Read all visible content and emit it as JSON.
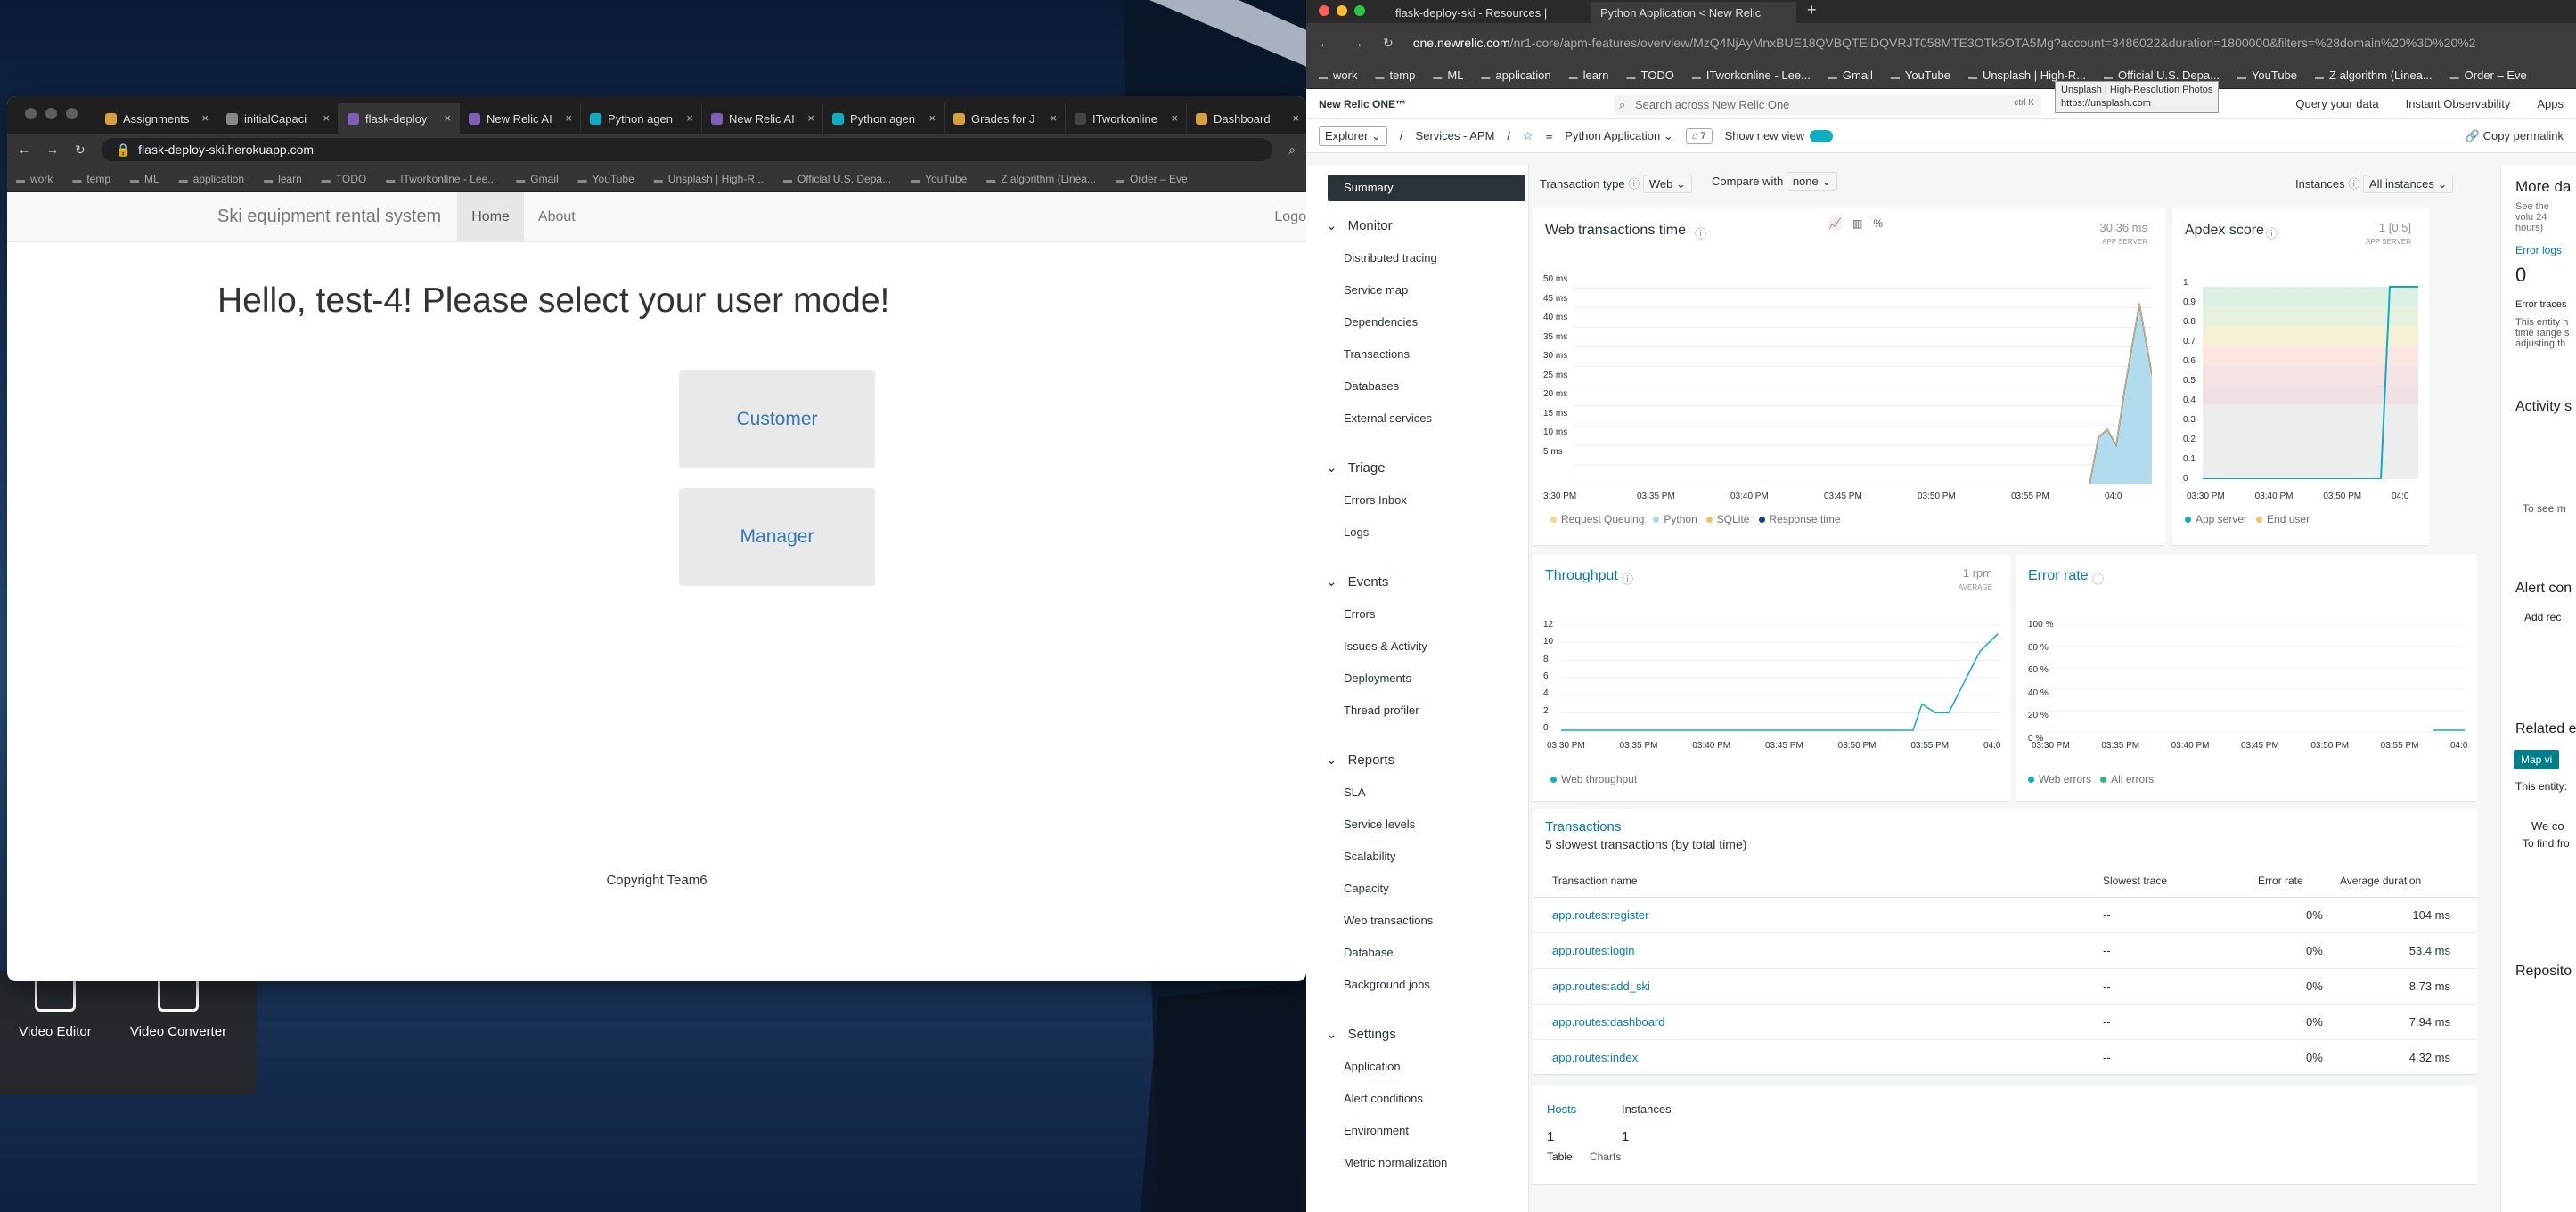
{
  "left_browser": {
    "tabs": [
      {
        "label": "Assignments",
        "color": "#d8a03a"
      },
      {
        "label": "initialCapaci",
        "color": "#888"
      },
      {
        "label": "flask-deploy",
        "color": "#7f5fb8"
      },
      {
        "label": "New Relic AI",
        "color": "#7f5fb8"
      },
      {
        "label": "Python agen",
        "color": "#0ab0bf"
      },
      {
        "label": "New Relic AI",
        "color": "#7f5fb8"
      },
      {
        "label": "Python agen",
        "color": "#0ab0bf"
      },
      {
        "label": "Grades for J",
        "color": "#d8a03a"
      },
      {
        "label": "ITworkonline",
        "color": "#444"
      },
      {
        "label": "Dashboard",
        "color": "#d8a03a"
      }
    ],
    "url": "flask-deploy-ski.herokuapp.com",
    "bookmarks": [
      "work",
      "temp",
      "ML",
      "application",
      "learn",
      "TODO",
      "ITworkonline - Lee...",
      "Gmail",
      "YouTube",
      "Unsplash | High-R...",
      "Official U.S. Depa...",
      "YouTube",
      "Z algorithm (Linea...",
      "Order – Eve"
    ]
  },
  "ski_app": {
    "brand": "Ski equipment rental system",
    "nav_home": "Home",
    "nav_about": "About",
    "nav_logout": "Logo",
    "greeting": "Hello, test-4! Please select your user mode!",
    "customer": "Customer",
    "manager": "Manager",
    "copyright": "Copyright Team6"
  },
  "dock": {
    "video_editor": "Video Editor",
    "video_converter": "Video Converter"
  },
  "nr_browser": {
    "tab1": "flask-deploy-ski - Resources |",
    "tab2": "Python Application < New Relic",
    "url_host": "one.newrelic.com",
    "url_path": "/nr1-core/apm-features/overview/MzQ4NjAyMnxBUE18QVBQTElDQVRJT058MTE3OTk5OTA5Mg?account=3486022&duration=1800000&filters=%28domain%20%3D%20%2",
    "bookmarks": [
      "work",
      "temp",
      "ML",
      "application",
      "learn",
      "TODO",
      "ITworkonline - Lee...",
      "Gmail",
      "YouTube",
      "Unsplash | High-R...",
      "Official U.S. Depa...",
      "YouTube",
      "Z algorithm (Linea...",
      "Order – Eve"
    ],
    "tooltip_title": "Unsplash | High-Resolution Photos",
    "tooltip_url": "https://unsplash.com"
  },
  "newrelic": {
    "logo": "New Relic ONE™",
    "search": "Search across New Relic One",
    "search_shortcut": "ctrl  K",
    "query": "Query your data",
    "instant": "Instant Observability",
    "apps": "Apps",
    "explorer": "Explorer ⌄",
    "services": "Services - APM",
    "app_name": "Python Application ⌄",
    "tag_count": "7",
    "show_new_view": "Show new view",
    "copy_permalink": "Copy permalink",
    "transaction_type_label": "Transaction type",
    "transaction_type": "Web ⌄",
    "compare_label": "Compare with",
    "compare_value": "none ⌄",
    "instances_label": "Instances",
    "instances_value": "All instances ⌄",
    "side": {
      "summary": "Summary",
      "monitor": "Monitor",
      "monitor_items": [
        "Distributed tracing",
        "Service map",
        "Dependencies",
        "Transactions",
        "Databases",
        "External services"
      ],
      "triage": "Triage",
      "triage_items": [
        "Errors Inbox",
        "Logs"
      ],
      "events": "Events",
      "events_items": [
        "Errors",
        "Issues & Activity",
        "Deployments",
        "Thread profiler"
      ],
      "reports": "Reports",
      "reports_items": [
        "SLA",
        "Service levels",
        "Scalability",
        "Capacity",
        "Web transactions",
        "Database",
        "Background jobs"
      ],
      "settings": "Settings",
      "settings_items": [
        "Application",
        "Alert conditions",
        "Environment",
        "Metric normalization"
      ]
    },
    "right_col": {
      "more_title": "More da",
      "more_sub": "See the volu 24 hours)",
      "error_logs": "Error logs",
      "error_logs_count": "0",
      "error_traces": "Error traces",
      "error_traces_text": "This entity h time range s adjusting th",
      "activity": "Activity s",
      "to_see": "To see m",
      "alert": "Alert con",
      "add_rec": "Add rec",
      "related": "Related e",
      "map": "Map vi",
      "this_entity": "This entity:",
      "we_co": "We co",
      "to_find": "To find fro",
      "repo": "Reposito"
    }
  },
  "web_tx": {
    "title": "Web transactions time",
    "stat": "30.36 ms",
    "stat_sub": "APP SERVER",
    "ylabels": [
      "50 ms",
      "45 ms",
      "40 ms",
      "35 ms",
      "30 ms",
      "25 ms",
      "20 ms",
      "15 ms",
      "10 ms",
      "5 ms"
    ],
    "xlabels": [
      "3:30 PM",
      "03:35 PM",
      "03:40 PM",
      "03:45 PM",
      "03:50 PM",
      "03:55 PM",
      "04:0"
    ],
    "legend": [
      "Request Queuing",
      "Python",
      "SQLite",
      "Response time"
    ]
  },
  "apdex": {
    "title": "Apdex score",
    "stat": "1 [0.5]",
    "stat_sub": "APP SERVER",
    "ylabels": [
      "1",
      "0.9",
      "0.8",
      "0.7",
      "0.6",
      "0.5",
      "0.4",
      "0.3",
      "0.2",
      "0.1",
      "0"
    ],
    "xlabels": [
      "03:30 PM",
      "03:40 PM",
      "03:50 PM",
      "04:0"
    ],
    "legend": [
      "App server",
      "End user"
    ]
  },
  "throughput": {
    "title": "Throughput",
    "stat": "1 rpm",
    "stat_sub": "AVERAGE",
    "ylabels": [
      "12",
      "10",
      "8",
      "6",
      "4",
      "2",
      "0"
    ],
    "xlabels": [
      "03:30 PM",
      "03:35 PM",
      "03:40 PM",
      "03:45 PM",
      "03:50 PM",
      "03:55 PM",
      "04:0"
    ],
    "legend": [
      "Web throughput"
    ]
  },
  "error_rate": {
    "title": "Error rate",
    "ylabels": [
      "100 %",
      "80 %",
      "60 %",
      "40 %",
      "20 %",
      "0 %"
    ],
    "xlabels": [
      "03:30 PM",
      "03:35 PM",
      "03:40 PM",
      "03:45 PM",
      "03:50 PM",
      "03:55 PM",
      "04:0"
    ],
    "legend": [
      "Web errors",
      "All errors"
    ]
  },
  "transactions": {
    "title": "Transactions",
    "subtitle": "5 slowest transactions (by total time)",
    "headers": [
      "Transaction name",
      "Slowest trace",
      "Error rate",
      "Average duration"
    ],
    "rows": [
      {
        "name": "app.routes:register",
        "trace": "--",
        "err": "0%",
        "dur": "104 ms"
      },
      {
        "name": "app.routes:login",
        "trace": "--",
        "err": "0%",
        "dur": "53.4 ms"
      },
      {
        "name": "app.routes:add_ski",
        "trace": "--",
        "err": "0%",
        "dur": "8.73 ms"
      },
      {
        "name": "app.routes:dashboard",
        "trace": "--",
        "err": "0%",
        "dur": "7.94 ms"
      },
      {
        "name": "app.routes:index",
        "trace": "--",
        "err": "0%",
        "dur": "4.32 ms"
      }
    ]
  },
  "hosts": {
    "hosts_label": "Hosts",
    "instances_label": "Instances",
    "hosts_count": "1",
    "instances_count": "1",
    "table": "Table",
    "charts": "Charts"
  },
  "chart_data": [
    {
      "type": "area",
      "title": "Web transactions time",
      "x": [
        "15:55",
        "15:56",
        "15:57",
        "15:58",
        "15:59",
        "16:00",
        "16:01"
      ],
      "series": [
        {
          "name": "Python",
          "values": [
            0,
            12,
            14,
            10,
            25,
            46,
            28
          ]
        },
        {
          "name": "Response time",
          "values": [
            0,
            12,
            14,
            10,
            25,
            46,
            28
          ]
        }
      ],
      "ylim": [
        0,
        50
      ]
    },
    {
      "type": "line",
      "title": "Apdex score",
      "x": [
        "15:30",
        "15:55",
        "15:58",
        "16:01"
      ],
      "series": [
        {
          "name": "App server",
          "values": [
            0,
            0,
            1,
            1
          ]
        }
      ],
      "ylim": [
        0,
        1
      ]
    },
    {
      "type": "line",
      "title": "Throughput",
      "x": [
        "15:55",
        "15:56",
        "15:57",
        "15:58",
        "15:59",
        "16:00",
        "16:01"
      ],
      "series": [
        {
          "name": "Web throughput",
          "values": [
            0,
            3,
            2,
            2,
            6,
            9,
            11
          ]
        }
      ],
      "ylim": [
        0,
        12
      ]
    },
    {
      "type": "line",
      "title": "Error rate",
      "x": [
        "16:00",
        "16:01"
      ],
      "series": [
        {
          "name": "Web errors",
          "values": [
            0,
            0
          ]
        }
      ],
      "ylim": [
        0,
        100
      ]
    }
  ]
}
